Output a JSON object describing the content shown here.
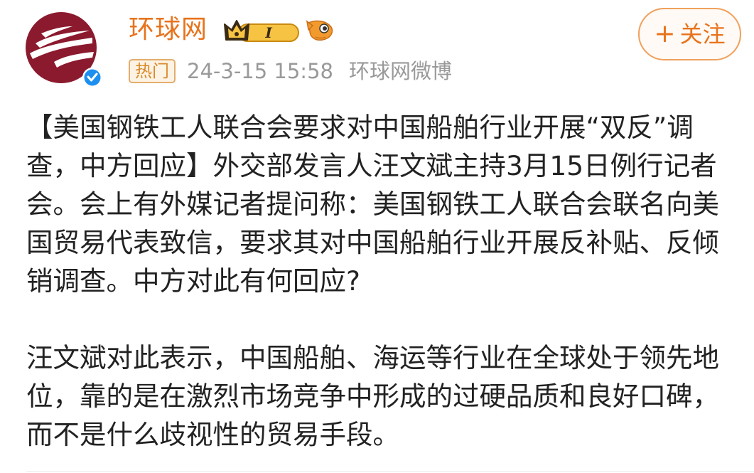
{
  "author": {
    "name": "环球网",
    "vip_level": "I"
  },
  "follow_button": {
    "plus": "+",
    "label": "关注"
  },
  "meta": {
    "hot_tag": "热门",
    "time": "24-3-15 15:58",
    "source": "环球网微博"
  },
  "post": {
    "paragraphs": [
      "【美国钢铁工人联合会要求对中国船舶行业开展“双反”调查，中方回应】外交部发言人汪文斌主持3月15日例行记者会。会上有外媒记者提问称：美国钢铁工人联合会联名向美国贸易代表致信，要求其对中国船舶行业开展反补贴、反倾销调查。中方对此有何回应?",
      "汪文斌对此表示，中国船舶、海运等行业在全球处于领先地位，靠的是在激烈市场竞争中形成的过硬品质和良好口碑，而不是什么歧视性的贸易手段。"
    ]
  },
  "colors": {
    "accent_orange": "#e8731c",
    "avatar_maroon": "#8b1a2e",
    "verified_blue": "#1d8ff0",
    "meta_gray": "#999999"
  },
  "icons": {
    "avatar": "globe-logo-avatar",
    "verified": "verified-badge-icon",
    "vip": "crown-vip-badge-icon",
    "fan": "fish-fan-badge-icon"
  }
}
